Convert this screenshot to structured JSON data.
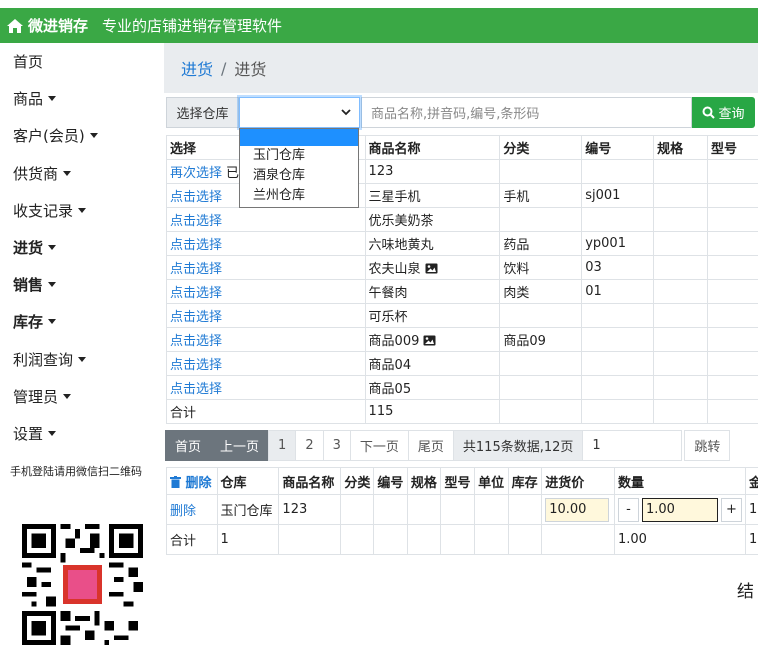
{
  "header": {
    "brand": "微进销存",
    "slogan": "专业的店铺进销存管理软件",
    "icon": "home-icon"
  },
  "sidebar": {
    "items": [
      {
        "label": "首页",
        "caret": false,
        "bold": false
      },
      {
        "label": "商品",
        "caret": true,
        "bold": false
      },
      {
        "label": "客户(会员)",
        "caret": true,
        "bold": false
      },
      {
        "label": "供货商",
        "caret": true,
        "bold": false
      },
      {
        "label": "收支记录",
        "caret": true,
        "bold": false
      },
      {
        "label": "进货",
        "caret": true,
        "bold": true
      },
      {
        "label": "销售",
        "caret": true,
        "bold": true
      },
      {
        "label": "库存",
        "caret": true,
        "bold": true
      },
      {
        "label": "利润查询",
        "caret": true,
        "bold": false
      },
      {
        "label": "管理员",
        "caret": true,
        "bold": false
      },
      {
        "label": "设置",
        "caret": true,
        "bold": false
      }
    ],
    "qr_caption": "手机登陆请用微信扫二维码"
  },
  "breadcrumb": {
    "parent": "进货",
    "separator": "/",
    "current": "进货"
  },
  "filter": {
    "warehouse_label": "选择仓库",
    "warehouse_value": "",
    "warehouse_options": [
      "",
      "玉门仓库",
      "酒泉仓库",
      "兰州仓库"
    ],
    "search_placeholder": "商品名称,拼音码,编号,条形码",
    "query_label": "查询"
  },
  "product_table": {
    "headers": [
      "选择",
      "商品名称",
      "分类",
      "编号",
      "规格",
      "型号"
    ],
    "rows": [
      {
        "select": "再次选择",
        "extra": "已",
        "name": "123",
        "category": "",
        "code": "",
        "image": false
      },
      {
        "select": "点击选择",
        "extra": "",
        "name": "三星手机",
        "category": "手机",
        "code": "sj001",
        "image": false
      },
      {
        "select": "点击选择",
        "extra": "",
        "name": "优乐美奶茶",
        "category": "",
        "code": "",
        "image": false
      },
      {
        "select": "点击选择",
        "extra": "",
        "name": "六味地黄丸",
        "category": "药品",
        "code": "yp001",
        "image": false
      },
      {
        "select": "点击选择",
        "extra": "",
        "name": "农夫山泉",
        "category": "饮料",
        "code": "03",
        "image": true
      },
      {
        "select": "点击选择",
        "extra": "",
        "name": "午餐肉",
        "category": "肉类",
        "code": "01",
        "image": false
      },
      {
        "select": "点击选择",
        "extra": "",
        "name": "可乐杯",
        "category": "",
        "code": "",
        "image": false
      },
      {
        "select": "点击选择",
        "extra": "",
        "name": "商品009",
        "category": "商品09",
        "code": "",
        "image": true
      },
      {
        "select": "点击选择",
        "extra": "",
        "name": "商品04",
        "category": "",
        "code": "",
        "image": false
      },
      {
        "select": "点击选择",
        "extra": "",
        "name": "商品05",
        "category": "",
        "code": "",
        "image": false
      }
    ],
    "total_label": "合计",
    "total_value": "115"
  },
  "pager": {
    "first": "首页",
    "prev": "上一页",
    "pages": [
      "1",
      "2",
      "3"
    ],
    "current_page": "1",
    "next": "下一页",
    "last": "尾页",
    "info": "共115条数据,12页",
    "jump_value": "1",
    "jump": "跳转"
  },
  "order_table": {
    "delete_all": "删除",
    "headers": [
      "仓库",
      "商品名称",
      "分类",
      "编号",
      "规格",
      "型号",
      "单位",
      "库存",
      "进货价",
      "数量",
      "金"
    ],
    "row": {
      "delete": "删除",
      "warehouse": "玉门仓库",
      "name": "123",
      "price": "10.00",
      "qty": "1.00",
      "amount": "1"
    },
    "total": {
      "label": "合计",
      "count": "1",
      "qty": "1.00",
      "amount": "1"
    }
  },
  "footer_partial": "结"
}
